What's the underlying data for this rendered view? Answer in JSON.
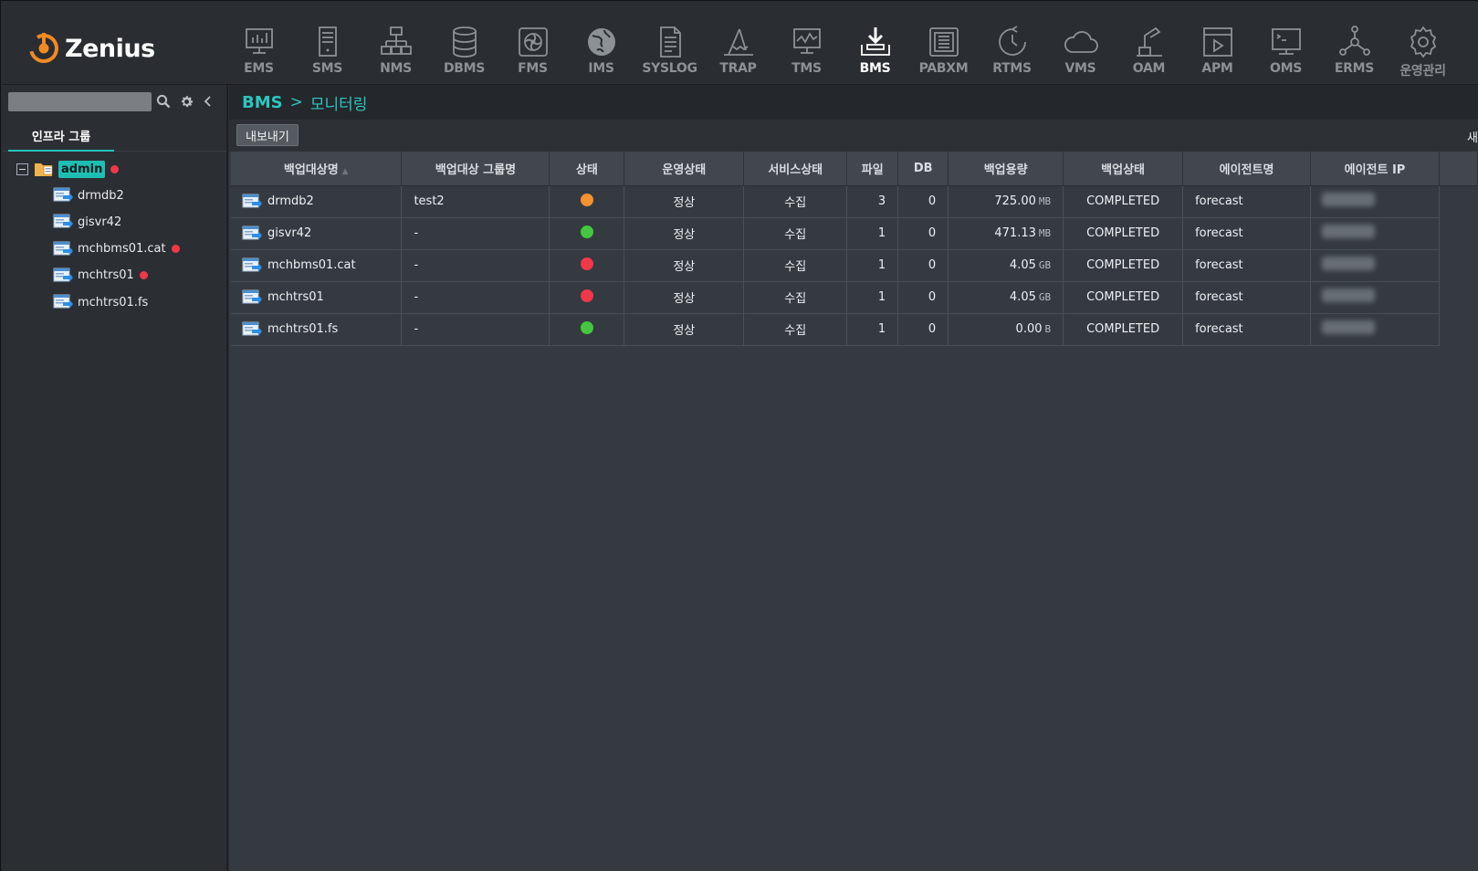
{
  "app": {
    "logo_text": "Zenius"
  },
  "modules": [
    {
      "id": "ems",
      "label": "EMS",
      "active": false
    },
    {
      "id": "sms",
      "label": "SMS",
      "active": false
    },
    {
      "id": "nms",
      "label": "NMS",
      "active": false
    },
    {
      "id": "dbms",
      "label": "DBMS",
      "active": false
    },
    {
      "id": "fms",
      "label": "FMS",
      "active": false
    },
    {
      "id": "ims",
      "label": "IMS",
      "active": false
    },
    {
      "id": "syslog",
      "label": "SYSLOG",
      "active": false
    },
    {
      "id": "trap",
      "label": "TRAP",
      "active": false
    },
    {
      "id": "tms",
      "label": "TMS",
      "active": false
    },
    {
      "id": "bms",
      "label": "BMS",
      "active": true
    },
    {
      "id": "pabxm",
      "label": "PABXM",
      "active": false
    },
    {
      "id": "rtms",
      "label": "RTMS",
      "active": false
    },
    {
      "id": "vms",
      "label": "VMS",
      "active": false
    },
    {
      "id": "oam",
      "label": "OAM",
      "active": false
    },
    {
      "id": "apm",
      "label": "APM",
      "active": false
    },
    {
      "id": "oms",
      "label": "OMS",
      "active": false
    },
    {
      "id": "erms",
      "label": "ERMS",
      "active": false
    },
    {
      "id": "admin",
      "label": "운영관리",
      "active": false
    }
  ],
  "sidebar": {
    "search_value": "",
    "tab_label": "인프라 그룹",
    "tree": {
      "root": {
        "label": "admin",
        "alert": true
      },
      "children": [
        {
          "label": "drmdb2",
          "alert": false
        },
        {
          "label": "gisvr42",
          "alert": false
        },
        {
          "label": "mchbms01.cat",
          "alert": true
        },
        {
          "label": "mchtrs01",
          "alert": true
        },
        {
          "label": "mchtrs01.fs",
          "alert": false
        }
      ]
    }
  },
  "breadcrumb": {
    "section": "BMS",
    "separator": ">",
    "page": "모니터링"
  },
  "toolbar": {
    "export_label": "내보내기",
    "refresh_label": "새"
  },
  "table": {
    "columns": [
      "백업대상명",
      "백업대상 그룹명",
      "상태",
      "운영상태",
      "서비스상태",
      "파일",
      "DB",
      "백업용량",
      "백업상태",
      "에이전트명",
      "에이전트 IP"
    ],
    "rows": [
      {
        "name": "drmdb2",
        "group": "test2",
        "status_color": "#f5922f",
        "op_status": "정상",
        "service_status": "수집",
        "files": "3",
        "db": "0",
        "size": "725.00",
        "unit": "MB",
        "backup_status": "COMPLETED",
        "agent": "forecast"
      },
      {
        "name": "gisvr42",
        "group": "-",
        "status_color": "#44c73f",
        "op_status": "정상",
        "service_status": "수집",
        "files": "1",
        "db": "0",
        "size": "471.13",
        "unit": "MB",
        "backup_status": "COMPLETED",
        "agent": "forecast"
      },
      {
        "name": "mchbms01.cat",
        "group": "-",
        "status_color": "#f0384a",
        "op_status": "정상",
        "service_status": "수집",
        "files": "1",
        "db": "0",
        "size": "4.05",
        "unit": "GB",
        "backup_status": "COMPLETED",
        "agent": "forecast"
      },
      {
        "name": "mchtrs01",
        "group": "-",
        "status_color": "#f0384a",
        "op_status": "정상",
        "service_status": "수집",
        "files": "1",
        "db": "0",
        "size": "4.05",
        "unit": "GB",
        "backup_status": "COMPLETED",
        "agent": "forecast"
      },
      {
        "name": "mchtrs01.fs",
        "group": "-",
        "status_color": "#44c73f",
        "op_status": "정상",
        "service_status": "수집",
        "files": "1",
        "db": "0",
        "size": "0.00",
        "unit": "B",
        "backup_status": "COMPLETED",
        "agent": "forecast"
      }
    ]
  },
  "colors": {
    "accent": "#2cc6c0",
    "alert": "#f0384a",
    "logo_orange": "#f08a24"
  }
}
